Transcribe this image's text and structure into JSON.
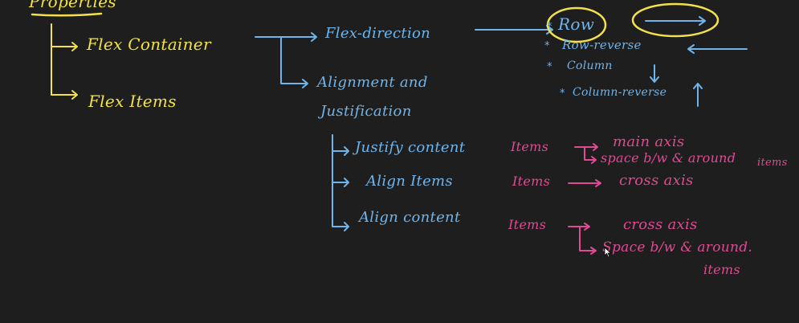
{
  "title": "Properties",
  "branches": {
    "flex_container": "Flex Container",
    "flex_items": "Flex Items"
  },
  "flex_direction": {
    "label": "Flex-direction",
    "options": [
      "Row",
      "Row-reverse",
      "Column",
      "Column-reverse"
    ]
  },
  "alignment": {
    "label_line1": "Alignment and",
    "label_line2": "Justification",
    "rows": [
      {
        "property": "Justify content",
        "items": "Items",
        "result_line1": "main axis",
        "result_line2": "space b/w & around",
        "result_line3": "items"
      },
      {
        "property": "Align Items",
        "items": "Items",
        "result_line1": "cross axis"
      },
      {
        "property": "Align content",
        "items": "Items",
        "result_line1": "cross axis",
        "result_line2": "Space b/w & around.",
        "result_line3": "items"
      }
    ]
  },
  "colors": {
    "background": "#1e1e1e",
    "yellow": "#f2e14a",
    "blue": "#6fb4ea",
    "pink": "#e04a93"
  }
}
